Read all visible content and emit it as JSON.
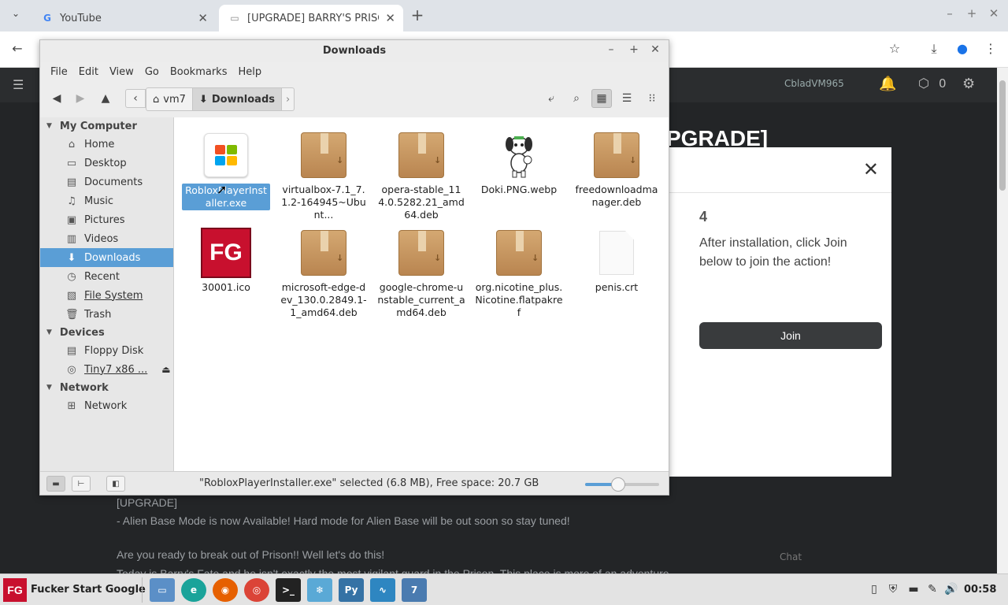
{
  "browser": {
    "tabs": [
      {
        "title": "YouTube",
        "active": false
      },
      {
        "title": "[UPGRADE] BARRY'S PRISON",
        "active": true
      }
    ],
    "page": {
      "heading_partial": "PGRADE]",
      "username": "CbladVM965",
      "robux": "0",
      "text_lines": [
        "[UPGRADE]",
        "- Alien Base Mode is now Available! Hard mode for Alien Base will be out soon so stay tuned!",
        "Are you ready to break out of Prison!! Well let's do this!",
        "Today is Barry's Fate and he isn't exactly the most vigilant guard in the Prison. This place is more of an adventure"
      ],
      "chat_label": "Chat"
    },
    "modal": {
      "step_number": "4",
      "instruction": "After installation, click Join below to join the action!",
      "join_label": "Join"
    }
  },
  "file_manager": {
    "window_title": "Downloads",
    "menu": [
      "File",
      "Edit",
      "View",
      "Go",
      "Bookmarks",
      "Help"
    ],
    "breadcrumbs": [
      "vm7",
      "Downloads"
    ],
    "sidebar": {
      "sections": [
        {
          "title": "My Computer",
          "items": [
            {
              "label": "Home",
              "icon": "home-icon"
            },
            {
              "label": "Desktop",
              "icon": "desktop-icon"
            },
            {
              "label": "Documents",
              "icon": "documents-icon"
            },
            {
              "label": "Music",
              "icon": "music-icon"
            },
            {
              "label": "Pictures",
              "icon": "pictures-icon"
            },
            {
              "label": "Videos",
              "icon": "videos-icon"
            },
            {
              "label": "Downloads",
              "icon": "download-icon",
              "selected": true
            },
            {
              "label": "Recent",
              "icon": "recent-icon"
            },
            {
              "label": "File System",
              "icon": "filesystem-icon"
            },
            {
              "label": "Trash",
              "icon": "trash-icon"
            }
          ]
        },
        {
          "title": "Devices",
          "items": [
            {
              "label": "Floppy Disk",
              "icon": "floppy-icon"
            },
            {
              "label": "Tiny7 x86 ...",
              "icon": "disc-icon"
            }
          ]
        },
        {
          "title": "Network",
          "items": [
            {
              "label": "Network",
              "icon": "network-icon"
            }
          ]
        }
      ]
    },
    "files": [
      {
        "name": "RobloxPlayerInstaller.exe",
        "type": "exe",
        "selected": true
      },
      {
        "name": "virtualbox-7.1_7.1.2-164945~Ubunt...",
        "type": "deb"
      },
      {
        "name": "opera-stable_114.0.5282.21_amd64.deb",
        "type": "deb"
      },
      {
        "name": "Doki.PNG.webp",
        "type": "image"
      },
      {
        "name": "freedownloadmanager.deb",
        "type": "deb"
      },
      {
        "name": "30001.ico",
        "type": "ico"
      },
      {
        "name": "microsoft-edge-dev_130.0.2849.1-1_amd64.deb",
        "type": "deb"
      },
      {
        "name": "google-chrome-unstable_current_amd64.deb",
        "type": "deb"
      },
      {
        "name": "org.nicotine_plus.Nicotine.flatpakref",
        "type": "deb"
      },
      {
        "name": "penis.crt",
        "type": "blank"
      }
    ],
    "status": "\"RobloxPlayerInstaller.exe\" selected (6.8 MB), Free space: 20.7 GB",
    "zoom_level": 0.45
  },
  "taskbar": {
    "start_label": "Fucker Start Google",
    "start_logo": "FG",
    "launchers": [
      "file-manager-icon",
      "edge-dev-icon",
      "firefox-icon",
      "chrome-icon",
      "terminal-icon",
      "snowflake-icon",
      "python-icon",
      "system-monitor-icon",
      "tiny7-icon"
    ],
    "clock": "00:58"
  }
}
